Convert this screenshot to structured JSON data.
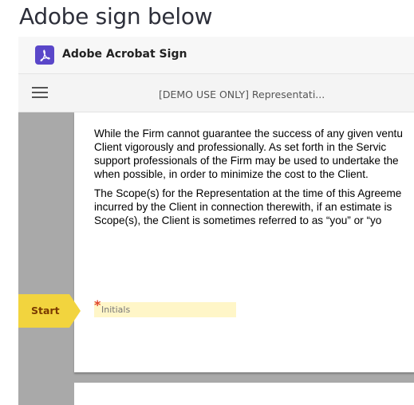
{
  "page": {
    "heading": "Adobe sign below"
  },
  "app": {
    "name": "Adobe Acrobat Sign",
    "logo_icon": "acrobat-logo-icon",
    "brand_color": "#5a47c9"
  },
  "toolbar": {
    "menu_icon": "hamburger-menu-icon",
    "document_title": "[DEMO USE ONLY] Representati..."
  },
  "document": {
    "paragraphs": [
      {
        "lines": [
          "While the Firm cannot guarantee the success of any given ventu",
          "Client vigorously and professionally. As set forth in the Servic",
          "support professionals of the Firm may be used to undertake the",
          "when possible, in order to minimize the cost to the Client."
        ]
      },
      {
        "lines": [
          "The Scope(s) for the Representation at the time of this Agreeme",
          "incurred by the Client in connection therewith, if an estimate is",
          "Scope(s), the Client is sometimes referred to as “you” or “yo"
        ]
      }
    ],
    "initials_field": {
      "label": "Initials",
      "required_marker": "*",
      "value": ""
    }
  },
  "start_button": {
    "label": "Start",
    "color": "#f2d43e"
  }
}
